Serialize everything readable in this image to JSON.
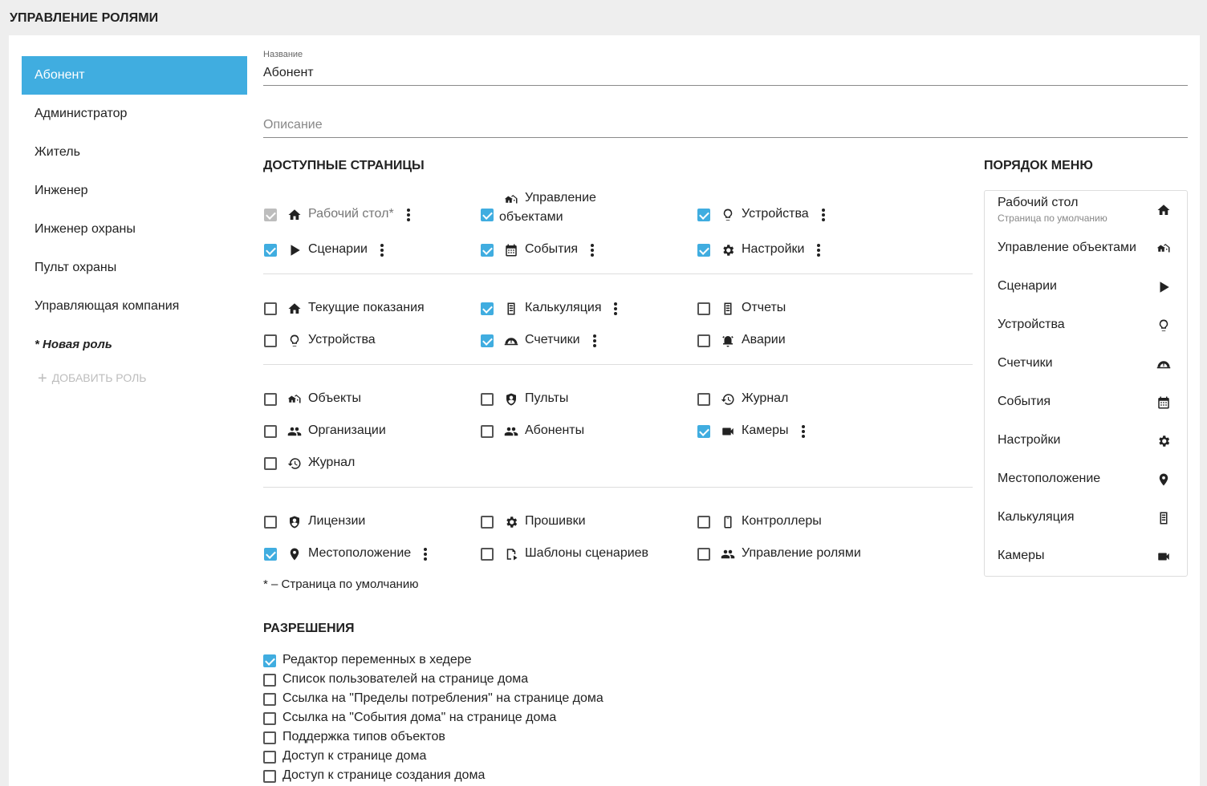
{
  "page_title": "УПРАВЛЕНИЕ РОЛЯМИ",
  "roles": [
    "Абонент",
    "Администратор",
    "Житель",
    "Инженер",
    "Инженер охраны",
    "Пульт охраны",
    "Управляющая компания"
  ],
  "new_role": "* Новая роль",
  "add_role": "ДОБАВИТЬ РОЛЬ",
  "form": {
    "name_label": "Название",
    "name_value": "Абонент",
    "description_placeholder": "Описание"
  },
  "pages_title": "ДОСТУПНЫЕ СТРАНИЦЫ",
  "groups": [
    [
      {
        "label": "Рабочий стол*",
        "icon": "home-icon",
        "checked": true,
        "disabled": true,
        "menu": true
      },
      {
        "label1": "Управление",
        "label2": "объектами",
        "icon": "buildings-icon",
        "checked": true,
        "menu": true
      },
      {
        "label": "Устройства",
        "icon": "bulb-icon",
        "checked": true,
        "menu": true
      },
      {
        "label": "Сценарии",
        "icon": "play-icon",
        "checked": true,
        "menu": true
      },
      {
        "label": "События",
        "icon": "calendar-icon",
        "checked": true,
        "menu": true
      },
      {
        "label": "Настройки",
        "icon": "gear-icon",
        "checked": true,
        "menu": true
      }
    ],
    [
      {
        "label": "Текущие показания",
        "icon": "home-icon",
        "checked": false
      },
      {
        "label": "Калькуляция",
        "icon": "document-icon",
        "checked": true,
        "menu": true
      },
      {
        "label": "Отчеты",
        "icon": "document-icon",
        "checked": false
      },
      {
        "label": "Устройства",
        "icon": "bulb-icon",
        "checked": false
      },
      {
        "label": "Счетчики",
        "icon": "gauge-icon",
        "checked": true,
        "menu": true
      },
      {
        "label": "Аварии",
        "icon": "alarm-icon",
        "checked": false
      }
    ],
    [
      {
        "label": "Объекты",
        "icon": "buildings-icon",
        "checked": false
      },
      {
        "label": "Пульты",
        "icon": "shield-icon",
        "checked": false
      },
      {
        "label": "Журнал",
        "icon": "history-icon",
        "checked": false
      },
      {
        "label": "Организации",
        "icon": "people-icon",
        "checked": false
      },
      {
        "label": "Абоненты",
        "icon": "people-icon",
        "checked": false
      },
      {
        "label": "Камеры",
        "icon": "camera-icon",
        "checked": true,
        "menu": true
      },
      {
        "label": "Журнал",
        "icon": "history-icon",
        "checked": false
      }
    ],
    [
      {
        "label": "Лицензии",
        "icon": "shield-icon",
        "checked": false
      },
      {
        "label": "Прошивки",
        "icon": "gear-icon",
        "checked": false
      },
      {
        "label": "Контроллеры",
        "icon": "controller-icon",
        "checked": false
      },
      {
        "label": "Местоположение",
        "icon": "pin-icon",
        "checked": true,
        "menu": true
      },
      {
        "label": "Шаблоны сценариев",
        "icon": "template-icon",
        "checked": false
      },
      {
        "label": "Управление ролями",
        "icon": "people-icon",
        "checked": false
      }
    ]
  ],
  "footnote": "* – Страница по умолчанию",
  "permissions_title": "РАЗРЕШЕНИЯ",
  "permissions": [
    {
      "label": "Редактор переменных в хедере",
      "checked": true
    },
    {
      "label": "Список пользователей на странице дома",
      "checked": false
    },
    {
      "label": "Ссылка на \"Пределы потребления\" на странице дома",
      "checked": false
    },
    {
      "label": "Ссылка на \"События дома\" на странице дома",
      "checked": false
    },
    {
      "label": "Поддержка типов объектов",
      "checked": false
    },
    {
      "label": "Доступ к странице дома",
      "checked": false
    },
    {
      "label": "Доступ к странице создания дома",
      "checked": false
    }
  ],
  "menu_order_title": "ПОРЯДОК МЕНЮ",
  "menu_order": [
    {
      "label": "Рабочий стол",
      "sub": "Страница по умолчанию",
      "icon": "home-icon"
    },
    {
      "label": "Управление объектами",
      "icon": "buildings-icon"
    },
    {
      "label": "Сценарии",
      "icon": "play-icon"
    },
    {
      "label": "Устройства",
      "icon": "bulb-icon"
    },
    {
      "label": "Счетчики",
      "icon": "gauge-icon"
    },
    {
      "label": "События",
      "icon": "calendar-icon"
    },
    {
      "label": "Настройки",
      "icon": "gear-icon"
    },
    {
      "label": "Местоположение",
      "icon": "pin-icon"
    },
    {
      "label": "Калькуляция",
      "icon": "document-icon"
    },
    {
      "label": "Камеры",
      "icon": "camera-icon"
    }
  ],
  "colors": {
    "accent": "#40ade0",
    "background": "#eeeeee"
  }
}
